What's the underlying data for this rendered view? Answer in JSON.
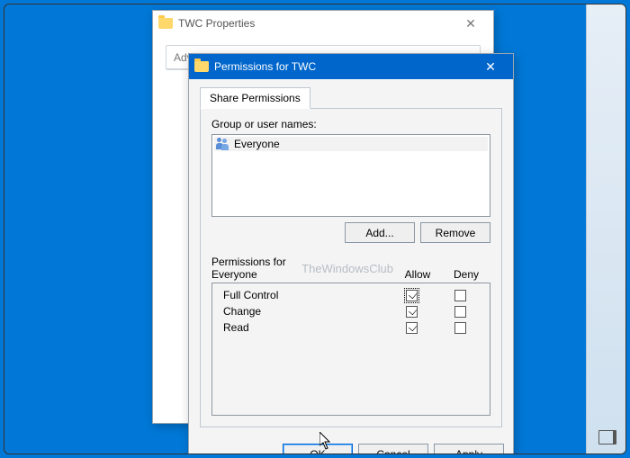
{
  "bg_window": {
    "title": "TWC Properties",
    "section": "Advanced Sharing"
  },
  "dialog": {
    "title": "Permissions for TWC",
    "tab": "Share Permissions",
    "group_label": "Group or user names:",
    "entries": [
      {
        "name": "Everyone"
      }
    ],
    "add_btn": "Add...",
    "remove_btn": "Remove",
    "perm_header_label": "Permissions for Everyone",
    "watermark": "TheWindowsClub",
    "col_allow": "Allow",
    "col_deny": "Deny",
    "permissions": [
      {
        "name": "Full Control",
        "allow": true,
        "deny": false,
        "focus": true
      },
      {
        "name": "Change",
        "allow": true,
        "deny": false
      },
      {
        "name": "Read",
        "allow": true,
        "deny": false
      }
    ],
    "ok": "OK",
    "cancel": "Cancel",
    "apply": "Apply"
  }
}
